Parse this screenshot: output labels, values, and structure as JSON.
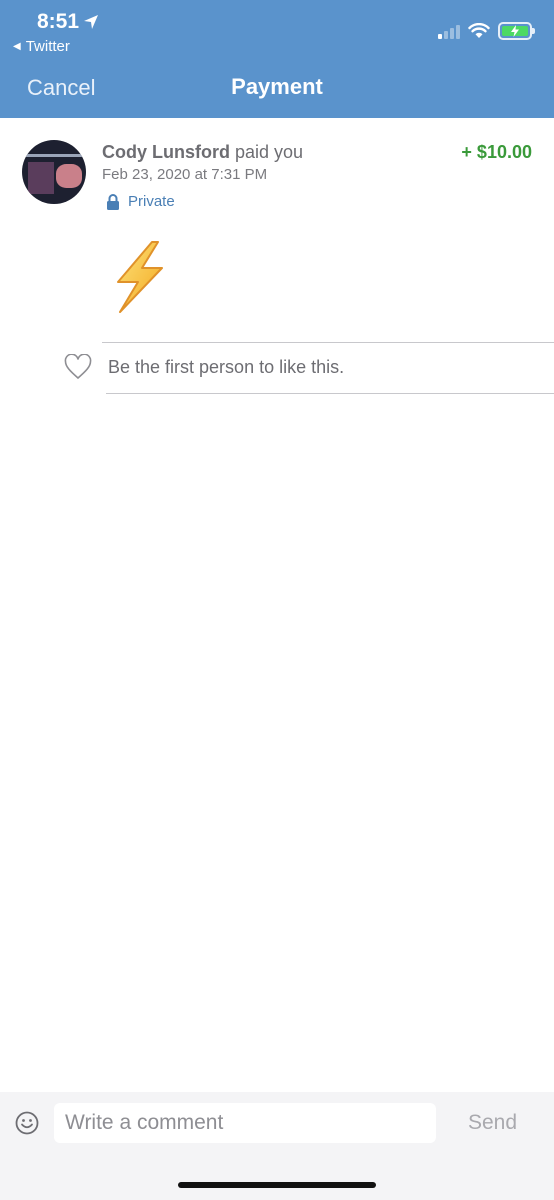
{
  "status_bar": {
    "time": "8:51",
    "back_app": "Twitter",
    "battery_color": "#4cd964"
  },
  "nav": {
    "cancel_label": "Cancel",
    "title": "Payment"
  },
  "payment": {
    "payer_name": "Cody Lunsford",
    "action_text": "paid you",
    "amount": "+ $10.00",
    "amount_color": "#3a9a3a",
    "date": "Feb 23, 2020 at 7:31 PM",
    "privacy_label": "Private",
    "note_icon": "lightning-bolt-emoji"
  },
  "likes": {
    "text": "Be the first person to like this."
  },
  "comment_bar": {
    "placeholder": "Write a comment",
    "send_label": "Send"
  },
  "colors": {
    "header_bg": "#5a93cc",
    "link_blue": "#4a7fb5"
  }
}
